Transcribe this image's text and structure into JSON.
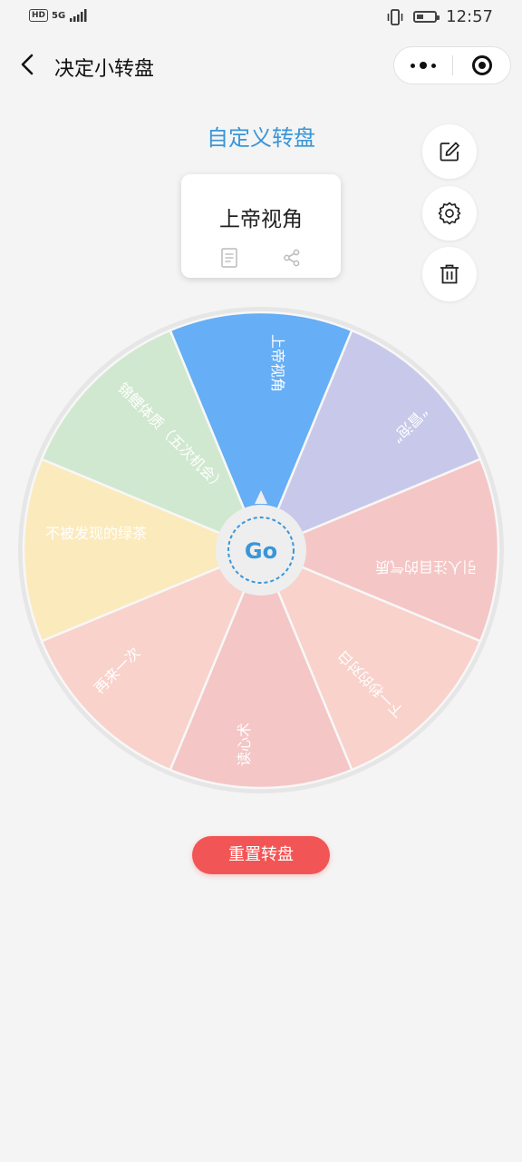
{
  "status_bar": {
    "hd_label": "HD",
    "network_label": "5G",
    "time": "12:57",
    "battery_level": 0.4
  },
  "navbar": {
    "title": "决定小转盘",
    "back_icon": "chevron-left-icon",
    "more_icon": "more-dots-icon",
    "close_icon": "target-icon"
  },
  "heading": "自定义转盘",
  "result_card": {
    "title": "上帝视角",
    "copy_icon": "document-icon",
    "share_icon": "share-icon"
  },
  "side_actions": [
    {
      "icon": "edit-icon"
    },
    {
      "icon": "gear-icon"
    },
    {
      "icon": "trash-icon"
    }
  ],
  "wheel": {
    "center_label": "Go",
    "ring_color": "#e6e6e6",
    "segments": [
      {
        "label": "上帝视角",
        "color": "#66aef5",
        "text_color": "#ffffff"
      },
      {
        "label": "“冒泡”",
        "color": "#c8c9ea",
        "text_color": "#ffffff"
      },
      {
        "label": "引人注目的气质",
        "color": "#f5c6c6",
        "text_color": "#ffffff"
      },
      {
        "label": "下一秒的对白",
        "color": "#f8d2cb",
        "text_color": "#ffffff"
      },
      {
        "label": "读心术",
        "color": "#f5c6c6",
        "text_color": "#ffffff"
      },
      {
        "label": "再来一次",
        "color": "#f8d2cb",
        "text_color": "#ffffff"
      },
      {
        "label": "不被发现的绿茶",
        "color": "#fbeabc",
        "text_color": "#ffffff"
      },
      {
        "label": "锦鲤体质（五次机会）",
        "color": "#d0e8cf",
        "text_color": "#ffffff"
      }
    ]
  },
  "reset_button": {
    "label": "重置转盘",
    "color": "#f25555"
  }
}
